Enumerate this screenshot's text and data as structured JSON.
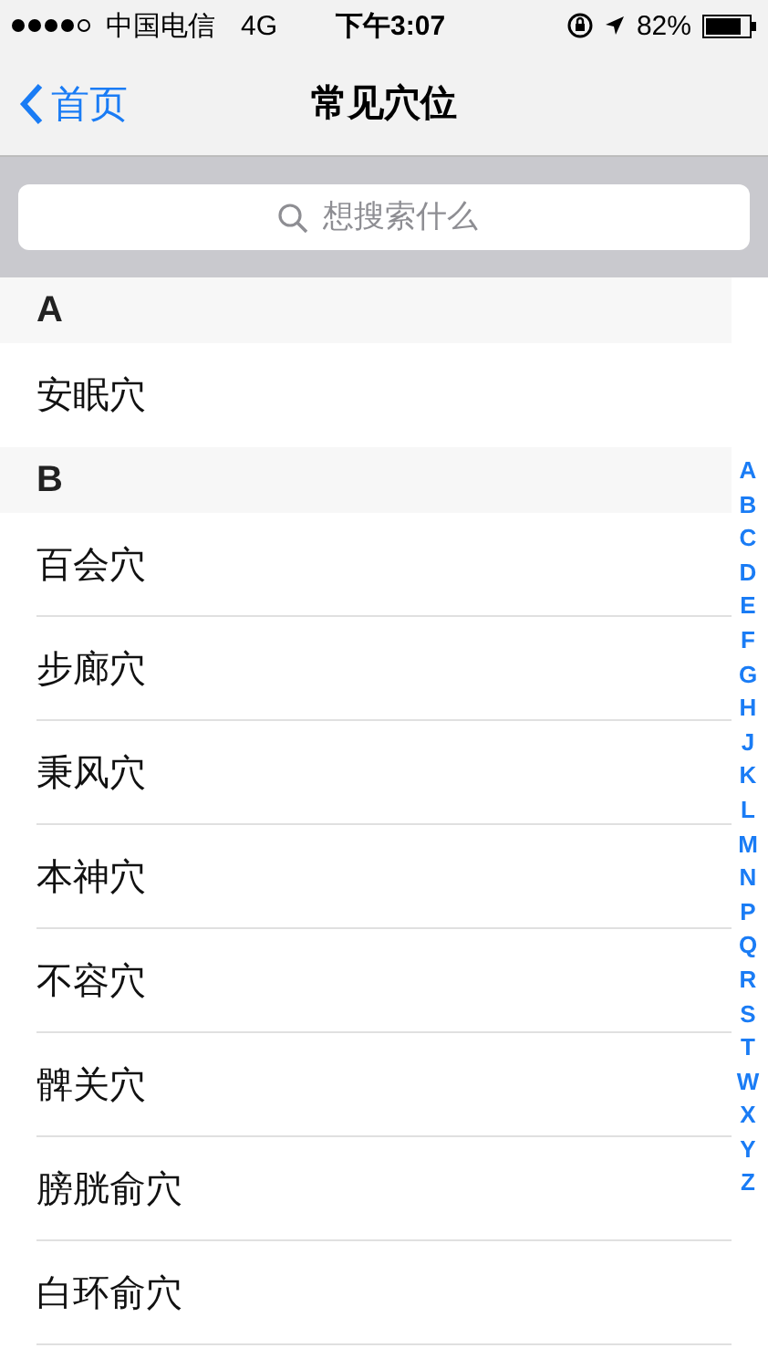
{
  "status_bar": {
    "carrier": "中国电信",
    "network": "4G",
    "time": "下午3:07",
    "battery": "82%"
  },
  "nav": {
    "back": "首页",
    "title": "常见穴位"
  },
  "search": {
    "placeholder": "想搜索什么"
  },
  "sections": [
    {
      "header": "A",
      "items": [
        "安眠穴"
      ]
    },
    {
      "header": "B",
      "items": [
        "百会穴",
        "步廊穴",
        "秉风穴",
        "本神穴",
        "不容穴",
        "髀关穴",
        "膀胱俞穴",
        "白环俞穴"
      ]
    }
  ],
  "index": [
    "A",
    "B",
    "C",
    "D",
    "E",
    "F",
    "G",
    "H",
    "J",
    "K",
    "L",
    "M",
    "N",
    "P",
    "Q",
    "R",
    "S",
    "T",
    "W",
    "X",
    "Y",
    "Z"
  ]
}
